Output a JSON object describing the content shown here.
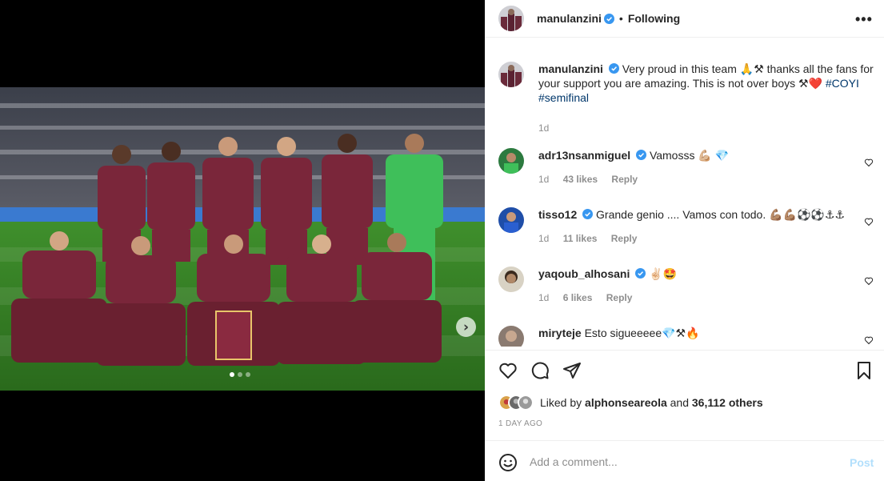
{
  "post": {
    "author": "manulanzini",
    "follow_sep": "•",
    "follow_label": "Following",
    "more_icon": "more-horizontal-icon",
    "more_glyph": "•••"
  },
  "caption": {
    "username": "manulanzini",
    "text": "Very proud in this team 🙏⚒ thanks all the fans for your support you are amazing. This is not over boys ⚒❤️ ",
    "hashtags": "#COYI #semifinal",
    "time": "1d"
  },
  "comments": [
    {
      "username": "adr13nsanmiguel",
      "verified": true,
      "text": "Vamosss 💪🏼 💎",
      "time": "1d",
      "likes": "43 likes",
      "reply": "Reply"
    },
    {
      "username": "tisso12",
      "verified": true,
      "text": "Grande genio .... Vamos con todo. 💪🏽💪🏽⚽⚽⚓⚓",
      "time": "1d",
      "likes": "11 likes",
      "reply": "Reply"
    },
    {
      "username": "yaqoub_alhosani",
      "verified": true,
      "text": "✌🏻🤩",
      "time": "1d",
      "likes": "6 likes",
      "reply": "Reply"
    },
    {
      "username": "miryteje",
      "verified": false,
      "text": "Esto sigueeeee💎⚒🔥",
      "time": "",
      "likes": "",
      "reply": ""
    }
  ],
  "likes": {
    "prefix": "Liked by ",
    "user": "alphonseareola",
    "middle": " and ",
    "count": "36,112 others"
  },
  "time_ago": "1 DAY AGO",
  "add_comment": {
    "placeholder": "Add a comment...",
    "post_label": "Post"
  },
  "carousel": {
    "next_glyph": "›",
    "dots": 3,
    "active_dot": 0
  },
  "colors": {
    "verified": "#3897f0",
    "link": "#00376b",
    "muted": "#8e8e8e",
    "post_disabled": "#b2dffc"
  }
}
